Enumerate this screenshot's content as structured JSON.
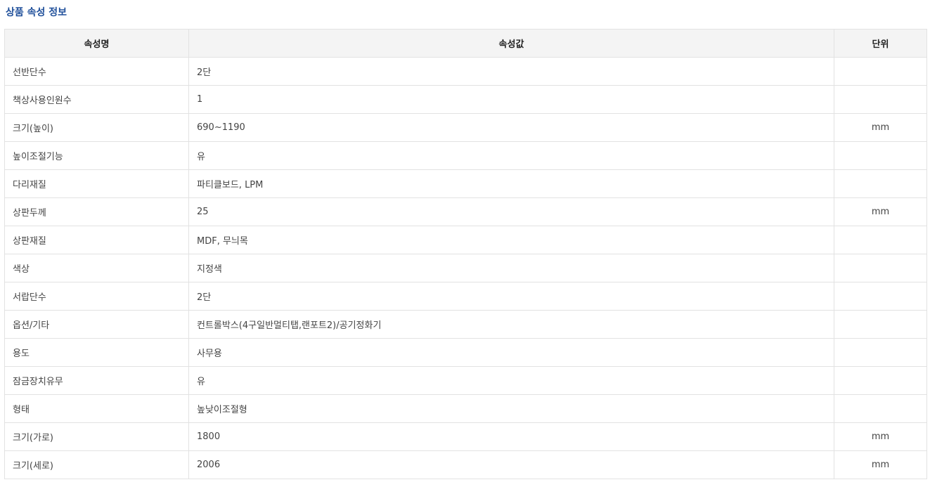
{
  "section": {
    "title": "상품 속성 정보"
  },
  "colors": {
    "title": "#1f4f9a",
    "header_bg": "#f4f4f4",
    "border": "#e2e2e2"
  },
  "table": {
    "headers": {
      "name": "속성명",
      "value": "속성값",
      "unit": "단위"
    },
    "rows": [
      {
        "name": "선반단수",
        "value": "2단",
        "unit": ""
      },
      {
        "name": "책상사용인원수",
        "value": "1",
        "unit": ""
      },
      {
        "name": "크기(높이)",
        "value": "690~1190",
        "unit": "mm"
      },
      {
        "name": "높이조절기능",
        "value": "유",
        "unit": ""
      },
      {
        "name": "다리재질",
        "value": "파티클보드, LPM",
        "unit": ""
      },
      {
        "name": "상판두께",
        "value": "25",
        "unit": "mm"
      },
      {
        "name": "상판재질",
        "value": "MDF, 무늬목",
        "unit": ""
      },
      {
        "name": "색상",
        "value": "지정색",
        "unit": ""
      },
      {
        "name": "서랍단수",
        "value": "2단",
        "unit": ""
      },
      {
        "name": "옵션/기타",
        "value": "컨트롤박스(4구일반멀티탭,랜포트2)/공기정화기",
        "unit": ""
      },
      {
        "name": "용도",
        "value": "사무용",
        "unit": ""
      },
      {
        "name": "잠금장치유무",
        "value": "유",
        "unit": ""
      },
      {
        "name": "형태",
        "value": "높낮이조절형",
        "unit": ""
      },
      {
        "name": "크기(가로)",
        "value": "1800",
        "unit": "mm"
      },
      {
        "name": "크기(세로)",
        "value": "2006",
        "unit": "mm"
      }
    ]
  }
}
